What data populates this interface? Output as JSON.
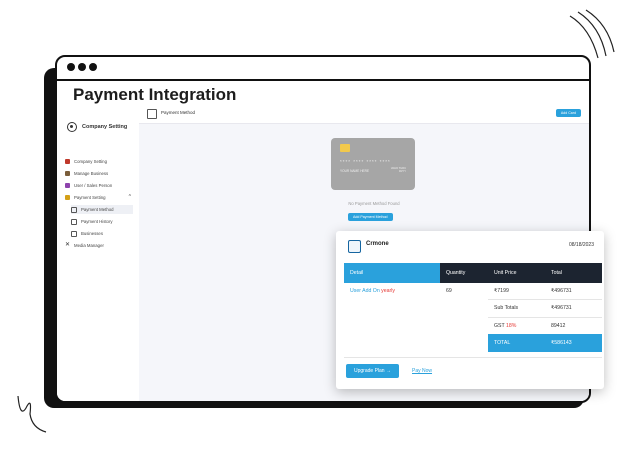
{
  "page_title": "Payment Integration",
  "sidebar": {
    "company_setting": "Company Setting",
    "items": [
      {
        "label": "Company Setting"
      },
      {
        "label": "Manage Business"
      },
      {
        "label": "User / Sales Person"
      },
      {
        "label": "Payment Setting"
      },
      {
        "label": "Payment Method"
      },
      {
        "label": "Payment History"
      },
      {
        "label": "Businesses"
      },
      {
        "label": "Media Manager"
      }
    ]
  },
  "content": {
    "title": "Payment Method",
    "add_card": "Add Card",
    "card": {
      "number": "**** **** **** ****",
      "name": "YOUR NAME HERE",
      "valid_label": "VALID THRU",
      "valid": "00/YY"
    },
    "no_payment": "No Payment Method Found",
    "add_payment": "Add Payment Method"
  },
  "popup": {
    "company": "Crmone",
    "date": "08/18/2023",
    "headers": [
      "Detail",
      "Quantity",
      "Unit Price",
      "Total"
    ],
    "row": {
      "detail": "User Add On",
      "period": "yearly",
      "quantity": "69",
      "unit_price": "₹7199",
      "total": "₹496731"
    },
    "subtotal_label": "Sub Totals",
    "subtotal": "₹496731",
    "gst_label": "GST",
    "gst_rate": "18%",
    "gst": "89412",
    "total_label": "TOTAL",
    "total": "₹586143",
    "upgrade": "Upgrade Plan →",
    "pay_now": "Pay Now"
  }
}
